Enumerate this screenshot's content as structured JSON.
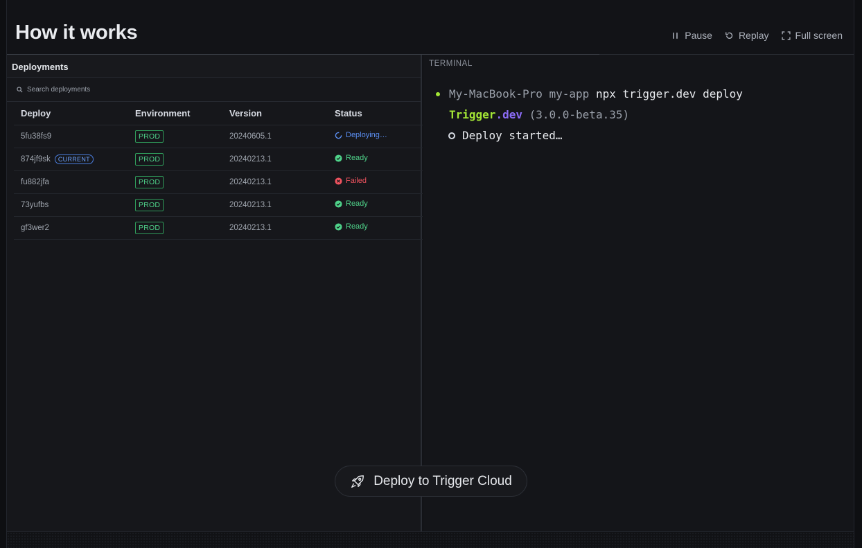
{
  "header": {
    "title": "How it works",
    "controls": {
      "pause": "Pause",
      "replay": "Replay",
      "fullscreen": "Full screen"
    }
  },
  "deployments": {
    "title": "Deployments",
    "search_placeholder": "Search deployments",
    "columns": [
      "Deploy",
      "Environment",
      "Version",
      "Status"
    ],
    "rows": [
      {
        "deploy": "5fu38fs9",
        "current": "",
        "env": "PROD",
        "version": "20240605.1",
        "status": "Deploying…",
        "status_kind": "deploying"
      },
      {
        "deploy": "874jf9sk",
        "current": "CURRENT",
        "env": "PROD",
        "version": "20240213.1",
        "status": "Ready",
        "status_kind": "ready"
      },
      {
        "deploy": "fu882jfa",
        "current": "",
        "env": "PROD",
        "version": "20240213.1",
        "status": "Failed",
        "status_kind": "failed"
      },
      {
        "deploy": "73yufbs",
        "current": "",
        "env": "PROD",
        "version": "20240213.1",
        "status": "Ready",
        "status_kind": "ready"
      },
      {
        "deploy": "gf3wer2",
        "current": "",
        "env": "PROD",
        "version": "20240213.1",
        "status": "Ready",
        "status_kind": "ready"
      }
    ]
  },
  "terminal": {
    "label": "TERMINAL",
    "line1": {
      "host": "My-MacBook-Pro",
      "dir": "my-app",
      "command": "npx trigger.dev deploy"
    },
    "line2": {
      "brand_a": "Trigger",
      "brand_b": ".dev",
      "version": "(3.0.0-beta.35)"
    },
    "line3": "Deploy started…"
  },
  "cta": {
    "label": "Deploy to Trigger Cloud"
  },
  "colors": {
    "accent_green": "#a3e635",
    "ready": "#4fd38a",
    "failed": "#f0535f",
    "deploying": "#5b8ff3",
    "purple": "#8b6cf6"
  }
}
